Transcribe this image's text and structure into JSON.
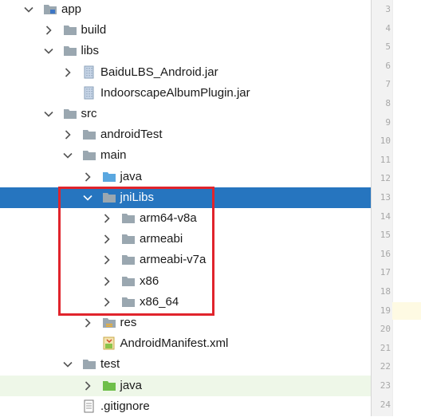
{
  "tree": {
    "rows": [
      {
        "label": "app",
        "indent": 0,
        "icon": "module-folder-icon",
        "expanded": true
      },
      {
        "label": "build",
        "indent": 1,
        "icon": "folder-icon",
        "expanded": false
      },
      {
        "label": "libs",
        "indent": 1,
        "icon": "folder-icon",
        "expanded": true
      },
      {
        "label": "BaiduLBS_Android.jar",
        "indent": 2,
        "icon": "jar-icon",
        "expanded": false
      },
      {
        "label": "IndoorscapeAlbumPlugin.jar",
        "indent": 2,
        "icon": "jar-icon",
        "expanded": null
      },
      {
        "label": "src",
        "indent": 1,
        "icon": "folder-icon",
        "expanded": true
      },
      {
        "label": "androidTest",
        "indent": 2,
        "icon": "folder-icon",
        "expanded": false
      },
      {
        "label": "main",
        "indent": 2,
        "icon": "folder-icon",
        "expanded": true
      },
      {
        "label": "java",
        "indent": 3,
        "icon": "source-folder-icon",
        "expanded": false
      },
      {
        "label": "jniLibs",
        "indent": 3,
        "icon": "folder-icon",
        "expanded": true,
        "selected": true
      },
      {
        "label": "arm64-v8a",
        "indent": 4,
        "icon": "folder-icon",
        "expanded": false
      },
      {
        "label": "armeabi",
        "indent": 4,
        "icon": "folder-icon",
        "expanded": false
      },
      {
        "label": "armeabi-v7a",
        "indent": 4,
        "icon": "folder-icon",
        "expanded": false
      },
      {
        "label": "x86",
        "indent": 4,
        "icon": "folder-icon",
        "expanded": false
      },
      {
        "label": "x86_64",
        "indent": 4,
        "icon": "folder-icon",
        "expanded": false
      },
      {
        "label": "res",
        "indent": 3,
        "icon": "resource-folder-icon",
        "expanded": false
      },
      {
        "label": "AndroidManifest.xml",
        "indent": 3,
        "icon": "manifest-icon",
        "expanded": null
      },
      {
        "label": "test",
        "indent": 2,
        "icon": "folder-icon",
        "expanded": true
      },
      {
        "label": "java",
        "indent": 3,
        "icon": "test-source-folder-icon",
        "expanded": false,
        "hover": true
      },
      {
        "label": ".gitignore",
        "indent": 2,
        "icon": "gitignore-icon",
        "expanded": null
      }
    ]
  },
  "gutter": {
    "line_numbers": [
      "3",
      "4",
      "5",
      "6",
      "7",
      "8",
      "9",
      "10",
      "11",
      "12",
      "13",
      "14",
      "15",
      "16",
      "17",
      "18",
      "19",
      "20",
      "21",
      "22",
      "23",
      "24"
    ],
    "current_line": "19"
  },
  "colors": {
    "selection": "#2675bf",
    "highlight_box": "#e0242c",
    "folder": "#9aa7b0",
    "source_folder": "#5aa7e0",
    "test_folder": "#6fbf4a"
  }
}
